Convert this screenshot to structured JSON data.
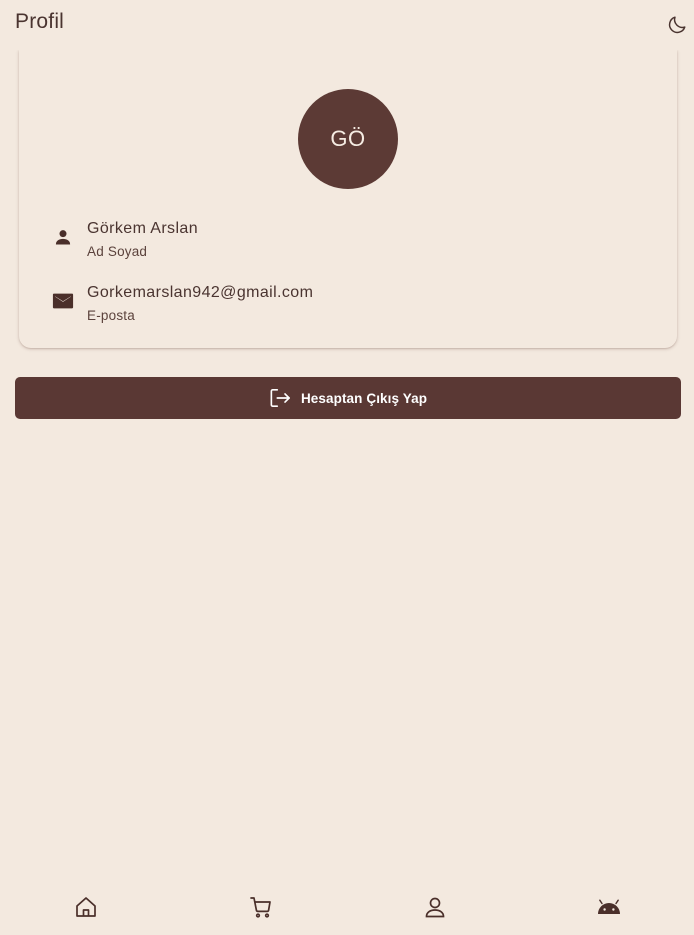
{
  "appbar": {
    "title": "Profil",
    "theme_icon": "moon-icon"
  },
  "profile": {
    "initials": "GÖ",
    "name": {
      "value": "Görkem Arslan",
      "label": "Ad Soyad",
      "icon": "person-icon"
    },
    "email": {
      "value": "Gorkemarslan942@gmail.com",
      "label": "E-posta",
      "icon": "mail-icon"
    }
  },
  "logout": {
    "label": "Hesaptan Çıkış Yap",
    "icon": "logout-icon"
  },
  "bottom_nav": {
    "items": [
      {
        "icon": "home-icon"
      },
      {
        "icon": "cart-icon"
      },
      {
        "icon": "profile-icon"
      },
      {
        "icon": "android-icon"
      }
    ]
  },
  "colors": {
    "background": "#f3e9df",
    "primary": "#5a3834",
    "text": "#4a3430",
    "on_primary": "#ffffff"
  }
}
